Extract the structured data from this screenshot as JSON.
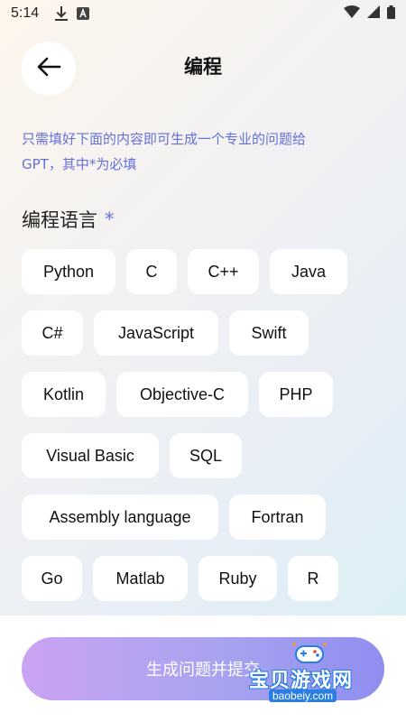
{
  "status": {
    "time": "5:14",
    "icons": [
      "download-icon",
      "keyboard-a-icon",
      "wifi-icon",
      "cellular-icon",
      "battery-icon"
    ]
  },
  "header": {
    "title": "编程",
    "back_icon": "arrow-left-icon"
  },
  "description": {
    "line1": "只需填好下面的内容即可生成一个专业的问题给",
    "line2": "GPT，其中*为必填"
  },
  "section": {
    "title": "编程语言",
    "required_mark": "*"
  },
  "languages": [
    "Python",
    "C",
    "C++",
    "Java",
    "C#",
    "JavaScript",
    "Swift",
    "Kotlin",
    "Objective-C",
    "PHP",
    "Visual Basic",
    "SQL",
    "Assembly language",
    "Fortran",
    "Go",
    "Matlab",
    "Ruby",
    "R"
  ],
  "submit": {
    "label": "生成问题并提交"
  },
  "watermark": {
    "text_cn": "宝贝游戏网",
    "text_en": "baobeiy.com",
    "icon": "gamepad-icon"
  },
  "colors": {
    "accent": "#6670d8",
    "button_gradient_start": "#caa3f2",
    "button_gradient_end": "#8f8ef0",
    "chip_bg": "#ffffff"
  }
}
